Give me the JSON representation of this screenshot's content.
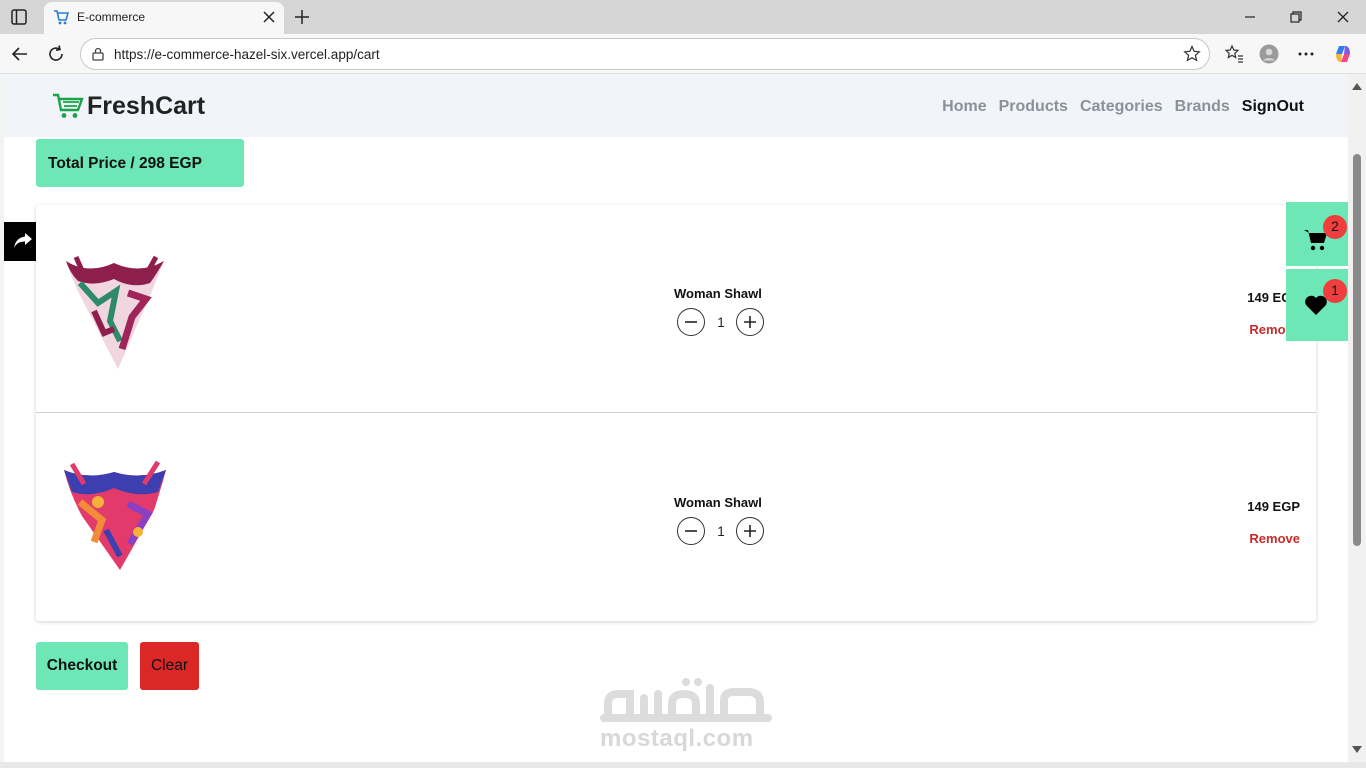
{
  "browser": {
    "tab_title": "E-commerce",
    "url": "https://e-commerce-hazel-six.vercel.app/cart"
  },
  "site": {
    "brand": "FreshCart",
    "nav": [
      "Home",
      "Products",
      "Categories",
      "Brands"
    ],
    "signout_label": "SignOut"
  },
  "cart": {
    "total_label": "Total Price / 298 EGP",
    "items": [
      {
        "name": "Woman Shawl",
        "quantity": "1",
        "price": "149 EGP",
        "remove_label": "Remove"
      },
      {
        "name": "Woman Shawl",
        "quantity": "1",
        "price": "149 EGP",
        "remove_label": "Remove"
      }
    ],
    "checkout_label": "Checkout",
    "clear_label": "Clear"
  },
  "floating": {
    "cart_count": "2",
    "wishlist_count": "1"
  },
  "watermark": {
    "text": "mostaql.com"
  },
  "colors": {
    "accent": "#6ce7b5",
    "danger": "#dc2727",
    "remove": "#c82b2b",
    "badge": "#ef3e3e"
  }
}
